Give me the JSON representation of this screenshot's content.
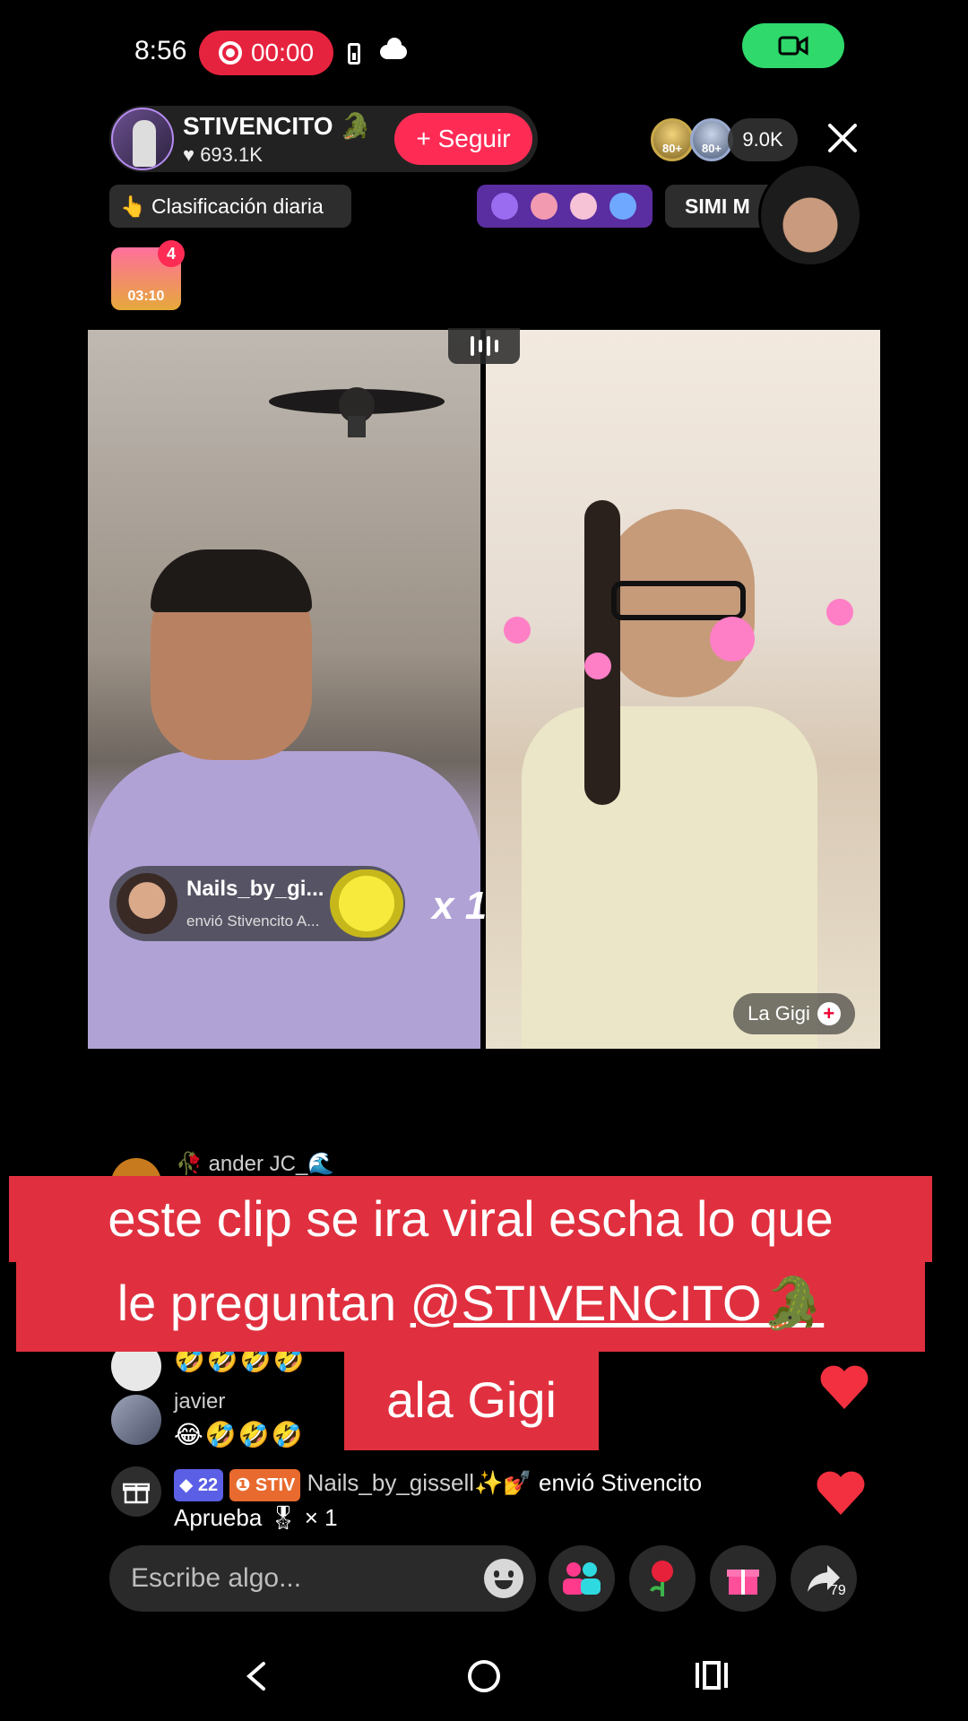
{
  "status_bar": {
    "time": "8:56",
    "record_time": "00:00"
  },
  "host": {
    "name": "STIVENCITO 🐊",
    "likes": "693.1K",
    "follow_label": "+ Seguir"
  },
  "badges": {
    "badge1": "80+",
    "badge2": "80+"
  },
  "viewers": "9.0K",
  "ranking_label": "👆 Clasificación diaria",
  "simi_label": "SIMI M",
  "chest": {
    "timer": "03:10",
    "count": "4"
  },
  "gift_banner": {
    "user": "Nails_by_gi...",
    "subtitle": "envió Stivencito A...",
    "multiplier": "x 1"
  },
  "guest": {
    "name": "La Gigi"
  },
  "comments": [
    {
      "name": "ander JC_🌊",
      "text": ""
    },
    {
      "name": "",
      "text": "🤣🤣🤣🤣"
    },
    {
      "name": "javier",
      "text": "😂🤣🤣🤣"
    }
  ],
  "gift_notification": {
    "level": "22",
    "club": "STIV",
    "user": "Nails_by_gissell✨💅",
    "line1": "envió Stivencito",
    "line2": "Aprueba 🎖 × 1"
  },
  "caption": {
    "line1": "este clip se ira viral escha lo que",
    "line2_prefix": "le preguntan  ",
    "line2_mention": "@STIVENCITO🐊",
    "line3": "ala Gigi"
  },
  "input": {
    "placeholder": "Escribe algo..."
  },
  "share_count": "79",
  "colors": {
    "accent": "#fe2c55",
    "caption_bg": "#e0303f",
    "cam_pill": "#2fd96b"
  }
}
